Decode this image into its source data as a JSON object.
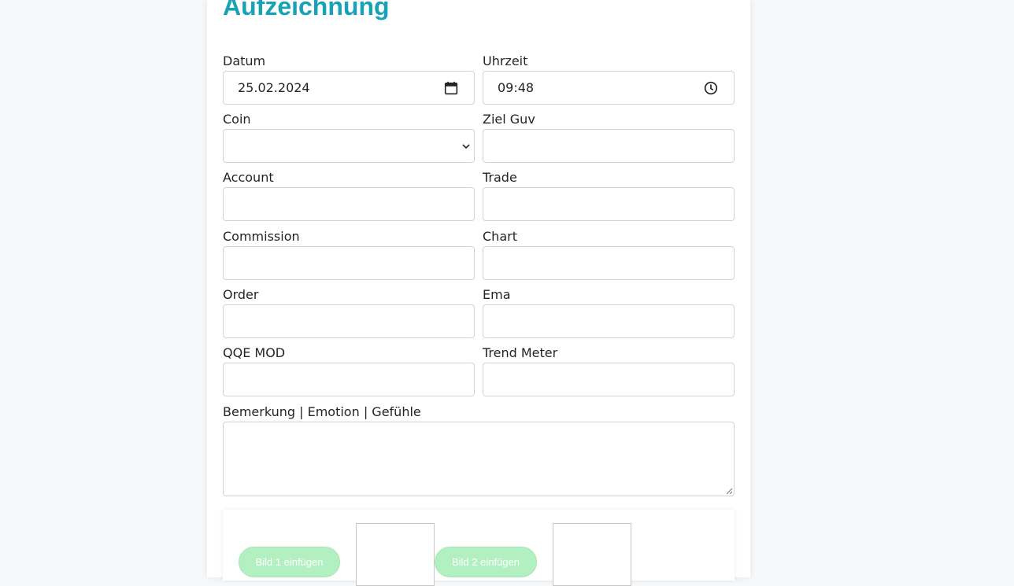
{
  "page": {
    "title": "Aufzeichnung"
  },
  "form": {
    "datum": {
      "label": "Datum",
      "value": "25.02.2024"
    },
    "uhrzeit": {
      "label": "Uhrzeit",
      "value": "09:48"
    },
    "coin": {
      "label": "Coin",
      "value": ""
    },
    "ziel_guv": {
      "label": "Ziel Guv",
      "value": ""
    },
    "account": {
      "label": "Account",
      "value": ""
    },
    "trade": {
      "label": "Trade",
      "value": ""
    },
    "commission": {
      "label": "Commission",
      "value": ""
    },
    "chart": {
      "label": "Chart",
      "value": ""
    },
    "order": {
      "label": "Order",
      "value": ""
    },
    "ema": {
      "label": "Ema",
      "value": ""
    },
    "qqe_mod": {
      "label": "QQE MOD",
      "value": ""
    },
    "trend_meter": {
      "label": "Trend Meter",
      "value": ""
    },
    "bemerkung": {
      "label": "Bemerkung | Emotion | Gefühle",
      "value": ""
    }
  },
  "images": {
    "bild1_label": "Bild 1 einfügen",
    "bild2_label": "Bild 2 einfügen"
  },
  "icons": {
    "date": "calendar-icon",
    "time": "clock-icon",
    "select": "chevron-down-icon",
    "resize": "resize-grip-icon"
  },
  "colors": {
    "accent": "#17a2b8",
    "upload_button": "#b3f0c1",
    "background": "#f7f8fa"
  }
}
